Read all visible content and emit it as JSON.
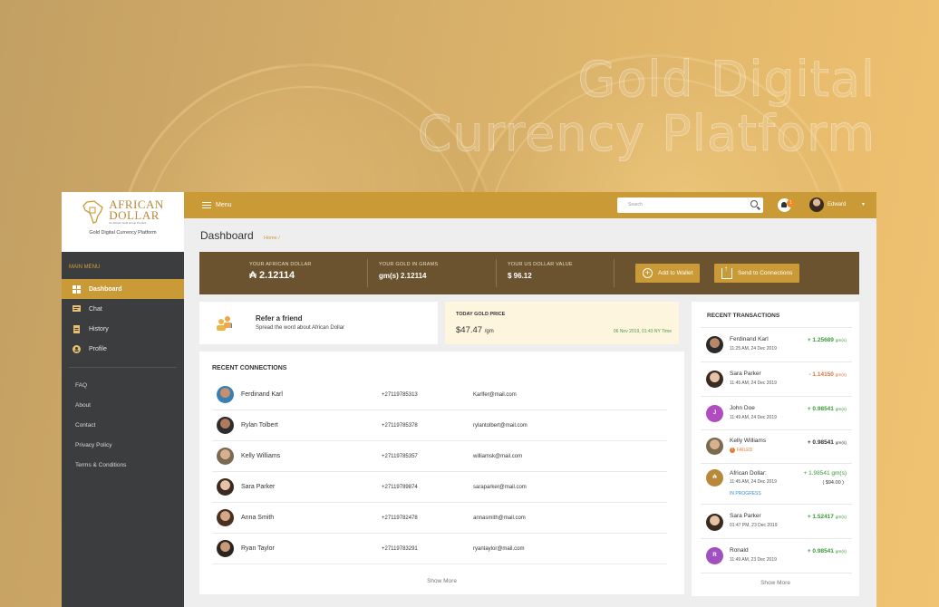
{
  "hero": {
    "line1": "Gold Digital",
    "line2": "Currency Platform"
  },
  "logo": {
    "name_line1": "AFRICAN",
    "name_line2": "DOLLAR",
    "sub": "An African Gold Group Product",
    "tagline": "Gold Digital Currency Platform"
  },
  "sidebar": {
    "menu_head": "MAIN MENU",
    "items": [
      {
        "label": "Dashboard",
        "icon": "dashboard-icon"
      },
      {
        "label": "Chat",
        "icon": "chat-icon"
      },
      {
        "label": "History",
        "icon": "history-icon"
      },
      {
        "label": "Profile",
        "icon": "profile-icon"
      }
    ],
    "links": [
      "FAQ",
      "About",
      "Contact",
      "Privacy Policy",
      "Terms & Conditions"
    ]
  },
  "topbar": {
    "menu_label": "Menu",
    "search_placeholder": "Search",
    "notif_count": "1",
    "user_name": "Edward"
  },
  "page": {
    "title": "Dashboard",
    "breadcrumb": "Home /"
  },
  "summary": {
    "african_dollar_label": "YOUR AFRICAN DOLLAR",
    "african_dollar_value": "2.12114",
    "gold_label": "YOUR GOLD IN GRAMS",
    "gold_value": "gm(s) 2.12114",
    "usd_label": "YOUR US DOLLAR VALUE",
    "usd_value": "$ 96.12",
    "add_wallet": "Add to Wallet",
    "send_connections": "Send to Connections"
  },
  "refer": {
    "title": "Refer a friend",
    "subtitle": "Spread the word about African Dollar"
  },
  "gold_price": {
    "label": "TODAY GOLD PRICE",
    "value": "$47.47",
    "unit": "/gm",
    "date": "06 Nov 2019, 01:43  NY Time"
  },
  "connections": {
    "title": "RECENT CONNECTIONS",
    "rows": [
      {
        "name": "Ferdinand Karl",
        "phone": "+27119785313",
        "email": "Karlfer@mail.com"
      },
      {
        "name": "Rylan Tolbert",
        "phone": "+27119785378",
        "email": "rylantolbert@mail.com"
      },
      {
        "name": "Kelly Williams",
        "phone": "+27119785357",
        "email": "williamsk@mail.com"
      },
      {
        "name": "Sara Parker",
        "phone": "+27119789874",
        "email": "saraparker@mail.com"
      },
      {
        "name": "Anna Smith",
        "phone": "+27119782478",
        "email": "annasmith@mail.com"
      },
      {
        "name": "Ryan Taylor",
        "phone": "+27119783291",
        "email": "ryantaylor@mail.com"
      }
    ],
    "show_more": "Show More"
  },
  "transactions": {
    "title": "RECENT TRANSACTIONS",
    "rows": [
      {
        "name": "Ferdinand Karl",
        "time": "11:25 AM, 24 Dec 2019",
        "amount": "+ 1.25689",
        "unit": "gm(s)"
      },
      {
        "name": "Sara Parker",
        "time": "11:45 AM, 24 Dec 2019",
        "amount": "- 1.14150",
        "unit": "gm(s)"
      },
      {
        "name": "John Doe",
        "initial": "J",
        "time": "11:49 AM, 24 Dec 2019",
        "amount": "+ 0.98541",
        "unit": "gm(s)"
      },
      {
        "name": "Kelly Williams",
        "status": "FAILED",
        "amount": "+ 0.98541",
        "unit": "gm(s)"
      },
      {
        "name": "African Dollar:",
        "time": "11:45 AM, 24 Dec 2019",
        "status": "IN PROGRESS",
        "amount": "+ 1.98541 gm(s)",
        "sub_amount": "( $94.00 )"
      },
      {
        "name": "Sara Parker",
        "time": "01:47 PM, 23 Dec 2019",
        "amount": "+ 1.52417",
        "unit": "gm(s)"
      },
      {
        "name": "Ronald",
        "initial": "R",
        "time": "11:49 AM, 23 Dec 2019",
        "amount": "+ 0.98541",
        "unit": "gm(s)"
      }
    ],
    "show_more": "Show More"
  },
  "colors": {
    "gold": "#c99a35",
    "dark": "#3c3d3f",
    "summary_bg": "#6b5330",
    "positive": "#3a9a3a",
    "negative": "#e0703a"
  }
}
